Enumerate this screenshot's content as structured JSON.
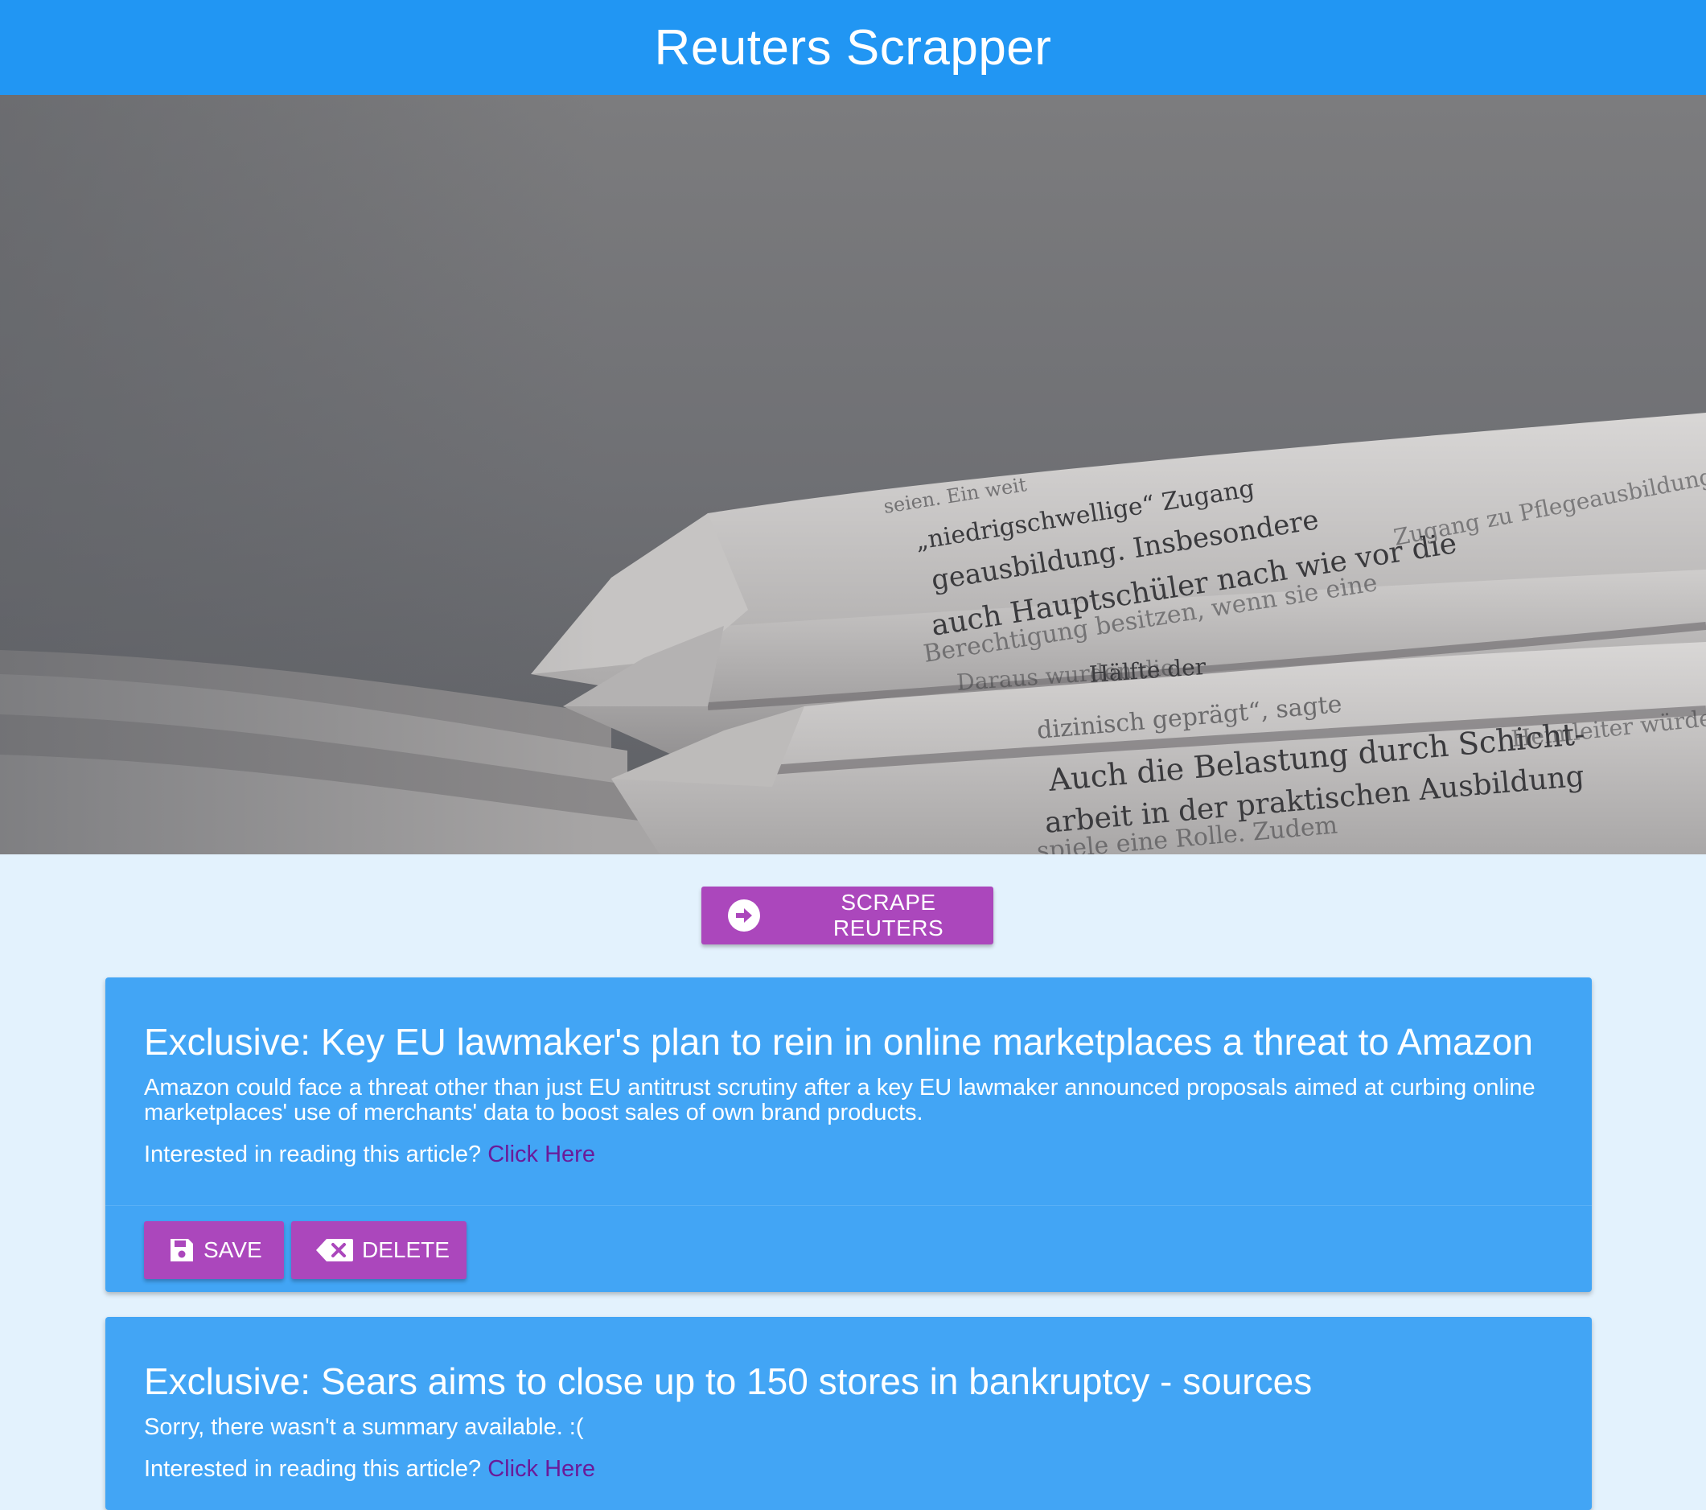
{
  "header": {
    "title": "Reuters Scrapper"
  },
  "hero": {
    "newspaper_lines": [
      "seien. Ein weit",
      "„niedrigschwellige“ Zugang",
      "geausbildung. Insbesondere",
      "auch Hauptschüler nach wie vor die",
      "Berechtigung besitzen, wenn sie eine",
      "Zugang zu Pflegeausbildung",
      "Daraus wurden die",
      "Hälfte der",
      "dizinisch geprägt“, sagte",
      "Auch die Belastung durch Schicht-",
      "arbeit in der praktischen Ausbildung",
      "spiele eine Rolle. Zudem",
      "Heimleiter würden wie Mus"
    ]
  },
  "scrape_button": {
    "label": "SCRAPE REUTERS",
    "icon": "arrow-right-circle-icon"
  },
  "articles": [
    {
      "title": "Exclusive: Key EU lawmaker's plan to rein in online marketplaces a threat to Amazon",
      "summary": "Amazon could face a threat other than just EU antitrust scrutiny after a key EU lawmaker announced proposals aimed at curbing online marketplaces' use of merchants' data to boost sales of own brand products.",
      "read_prompt": "Interested in reading this article?",
      "link_text": "Click Here",
      "save_label": "SAVE",
      "delete_label": "DELETE"
    },
    {
      "title": "Exclusive: Sears aims to close up to 150 stores in bankruptcy - sources",
      "summary": "Sorry, there wasn't a summary available. :(",
      "read_prompt": "Interested in reading this article?",
      "link_text": "Click Here"
    }
  ],
  "colors": {
    "header_bg": "#2196f3",
    "page_bg": "#e3f2fd",
    "card_bg": "#42a5f5",
    "button_bg": "#ab47bc",
    "link": "#6a1b9a"
  }
}
